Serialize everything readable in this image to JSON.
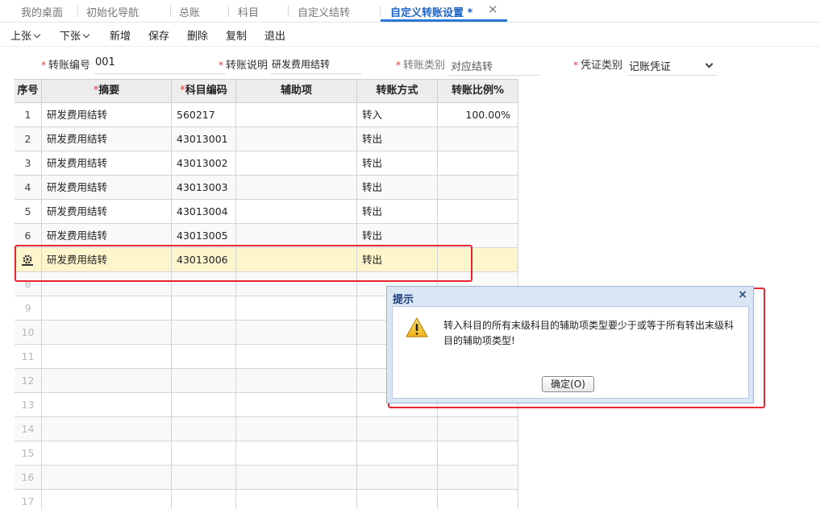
{
  "tabs": [
    {
      "label": "我的桌面"
    },
    {
      "label": "初始化导航"
    },
    {
      "label": "总账"
    },
    {
      "label": "科目"
    },
    {
      "label": "自定义结转"
    },
    {
      "label": "自定义转账设置 *"
    }
  ],
  "tab_close_glyph": "✕",
  "toolbar": {
    "prev_label": "上张",
    "next_label": "下张",
    "add_label": "新增",
    "save_label": "保存",
    "delete_label": "删除",
    "copy_label": "复制",
    "exit_label": "退出"
  },
  "form": {
    "required_mark": "*",
    "transfer_no_label": "转账编号",
    "transfer_no_value": "001",
    "transfer_desc_label": "转账说明",
    "transfer_desc_value": "研发费用结转",
    "transfer_type_label": "转账类别",
    "transfer_type_value": "对应结转",
    "voucher_type_label": "凭证类别",
    "voucher_type_value": "记账凭证"
  },
  "grid": {
    "headers": {
      "seq": "序号",
      "summary": "摘要",
      "account_code": "科目编码",
      "aux": "辅助项",
      "method": "转账方式",
      "ratio": "转账比例%"
    },
    "rows": [
      {
        "seq": "1",
        "summary": "研发费用结转",
        "account_code": "560217",
        "aux": "",
        "method": "转入",
        "ratio": "100.00%"
      },
      {
        "seq": "2",
        "summary": "研发费用结转",
        "account_code": "43013001",
        "aux": "",
        "method": "转出",
        "ratio": ""
      },
      {
        "seq": "3",
        "summary": "研发费用结转",
        "account_code": "43013002",
        "aux": "",
        "method": "转出",
        "ratio": ""
      },
      {
        "seq": "4",
        "summary": "研发费用结转",
        "account_code": "43013003",
        "aux": "",
        "method": "转出",
        "ratio": ""
      },
      {
        "seq": "5",
        "summary": "研发费用结转",
        "account_code": "43013004",
        "aux": "",
        "method": "转出",
        "ratio": ""
      },
      {
        "seq": "6",
        "summary": "研发费用结转",
        "account_code": "43013005",
        "aux": "",
        "method": "转出",
        "ratio": ""
      },
      {
        "seq": "",
        "summary": "研发费用结转",
        "account_code": "43013006",
        "aux": "",
        "method": "转出",
        "ratio": ""
      }
    ],
    "empty_row_numbers": [
      "8",
      "9",
      "10",
      "11",
      "12",
      "13",
      "14",
      "15",
      "16",
      "17"
    ]
  },
  "dialog": {
    "title": "提示",
    "close_glyph": "×",
    "message": "转入科目的所有末级科目的辅助项类型要少于或等于所有转出末级科目的辅助项类型!",
    "ok_label": "确定(O)"
  },
  "icons": {
    "row_gear": "gear-icon",
    "dialog_warning": "warning-icon",
    "dropdown": "chevron-down-icon"
  },
  "colors": {
    "accent": "#2a78d6",
    "required": "#e53935",
    "highlight_box": "#e8262d",
    "selected_row": "#fdf5cc",
    "dialog_frame": "#dbe6f5"
  }
}
